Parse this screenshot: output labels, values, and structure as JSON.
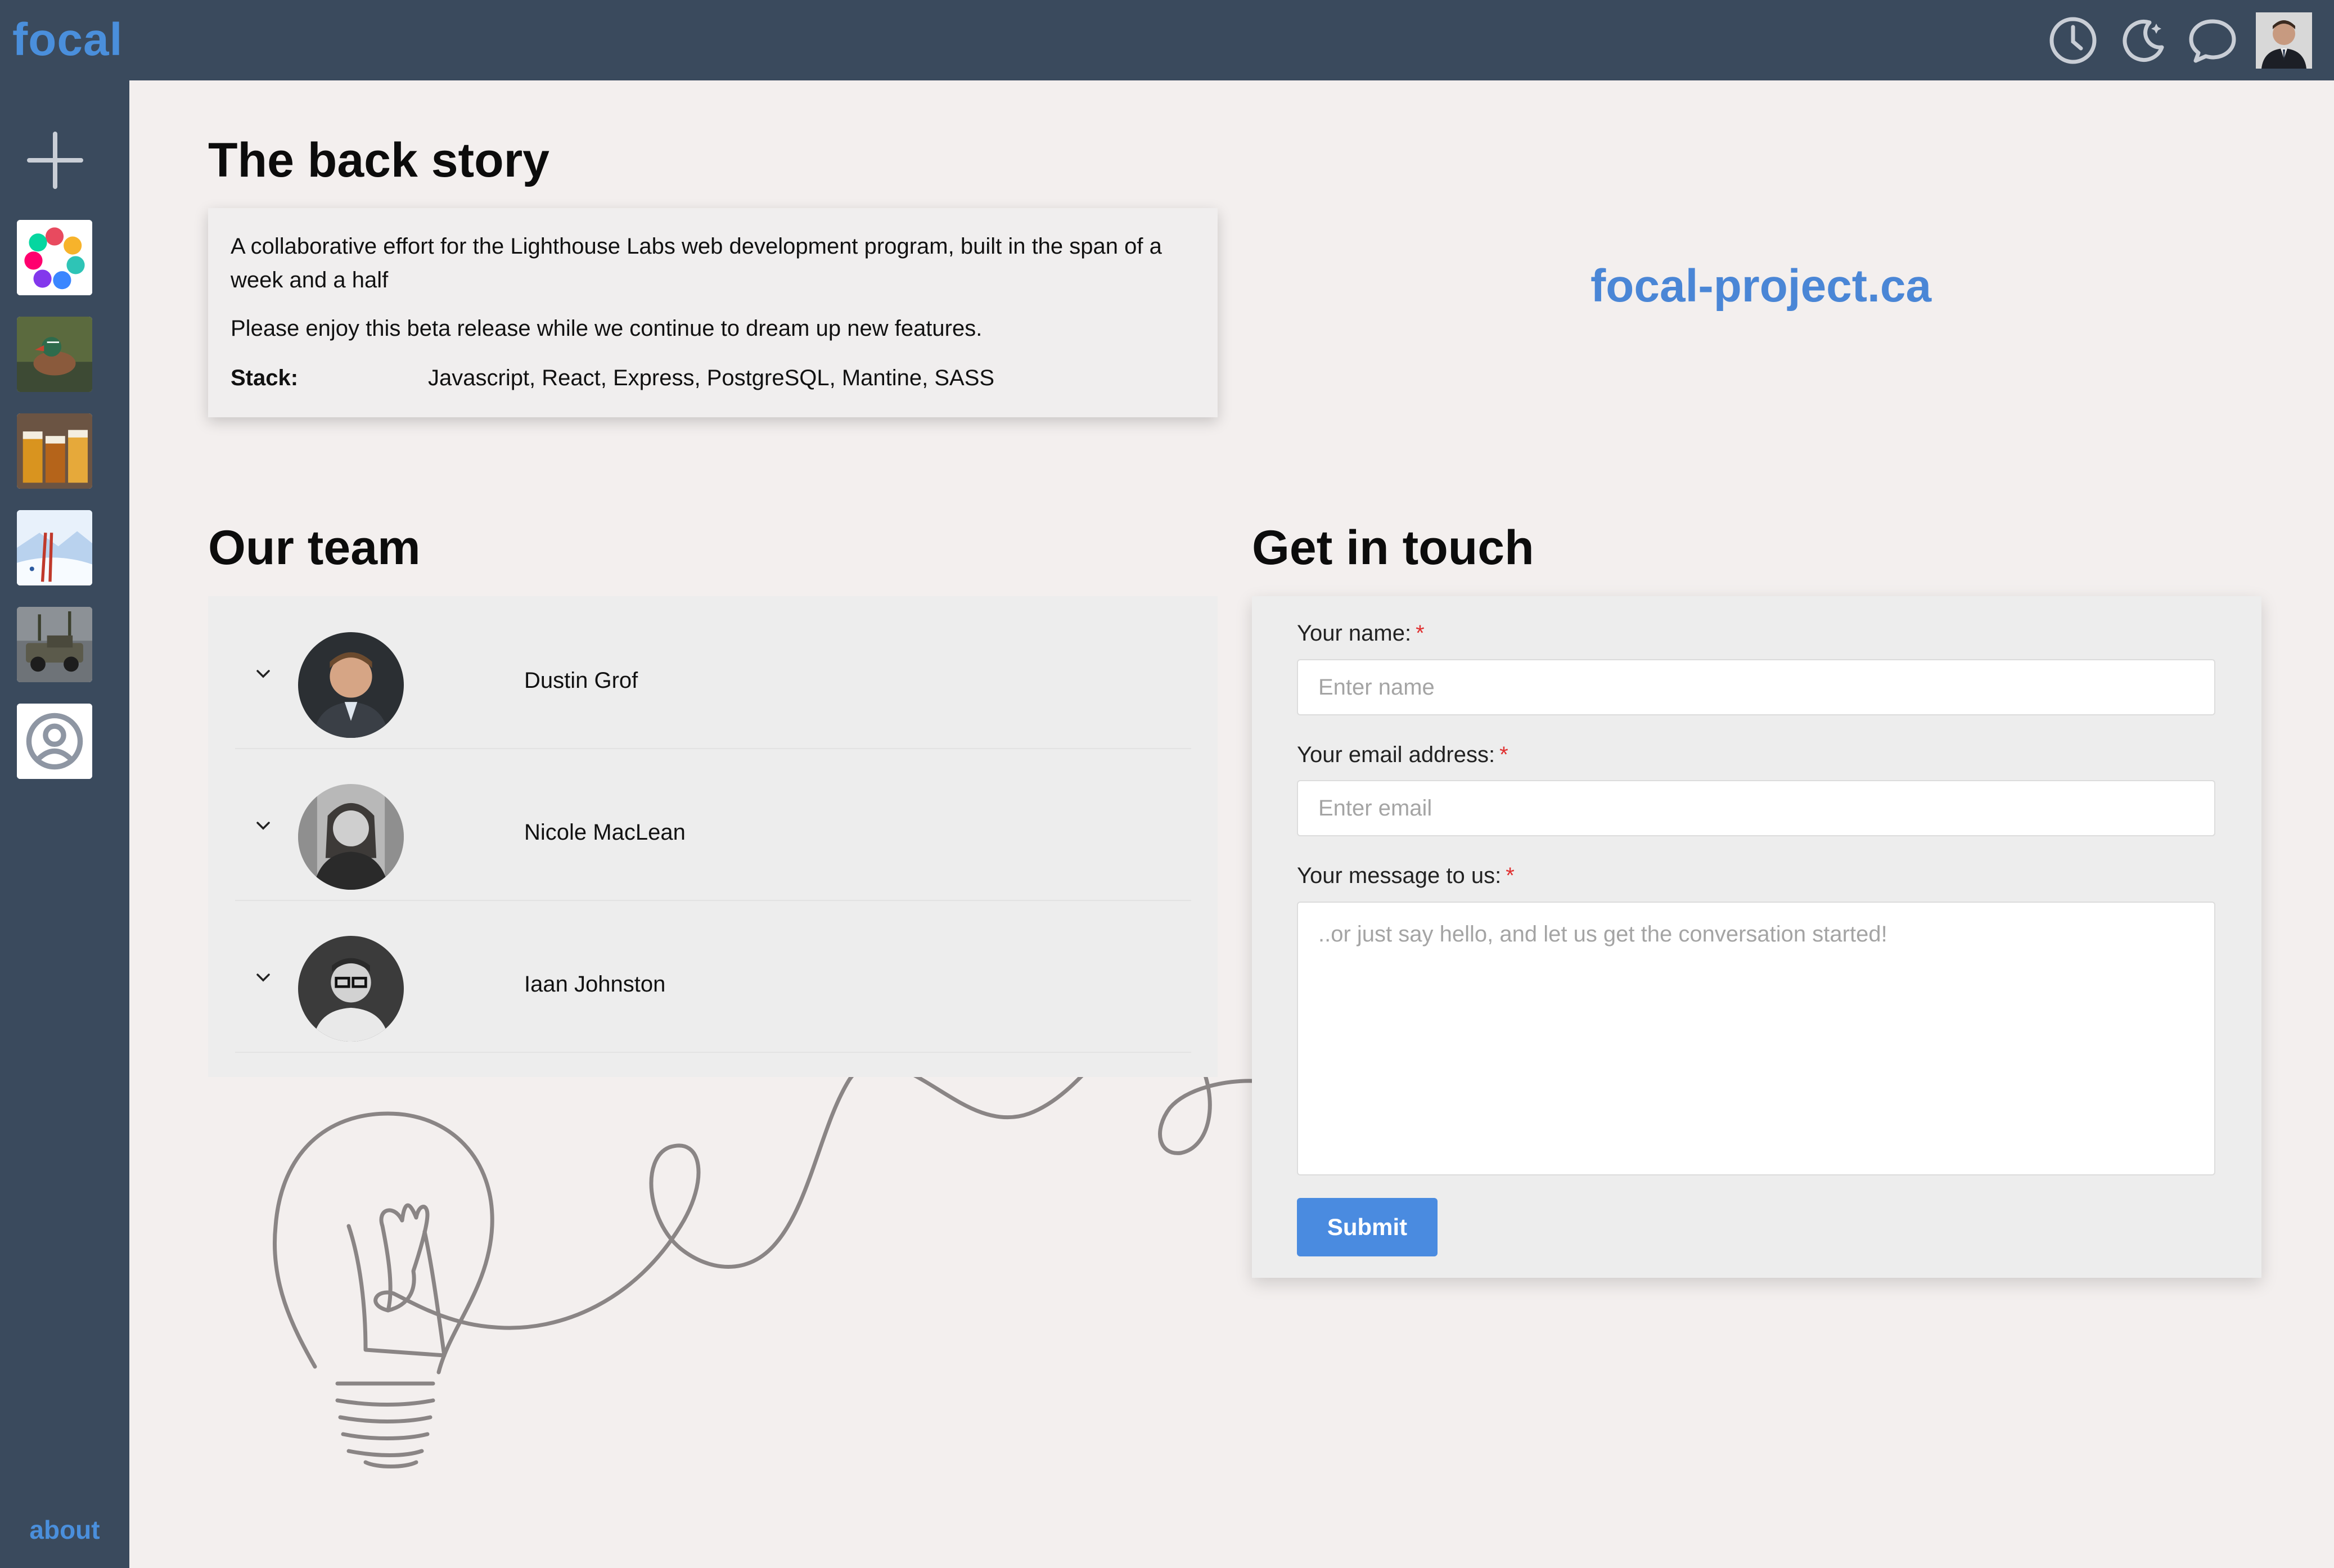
{
  "app": {
    "logo": "focal"
  },
  "topbar": {
    "icons": [
      "clock-icon",
      "dark-mode-moon-icon",
      "chat-bubble-icon",
      "user-avatar"
    ]
  },
  "sidebar": {
    "add_icon": "plus-icon",
    "items": [
      {
        "name": "sidebar-item-logo-board",
        "icon": "colorful-logo"
      },
      {
        "name": "sidebar-item-duck-board",
        "icon": "duck-photo"
      },
      {
        "name": "sidebar-item-beer-board",
        "icon": "beer-photo"
      },
      {
        "name": "sidebar-item-ski-board",
        "icon": "ski-illustration"
      },
      {
        "name": "sidebar-item-truck-board",
        "icon": "truck-photo"
      },
      {
        "name": "sidebar-item-profile",
        "icon": "user-circle-icon"
      }
    ],
    "about_label": "about"
  },
  "backstory": {
    "heading": "The back story",
    "paragraph1": "A collaborative effort for the Lighthouse Labs web development program, built in the span of a week and a half",
    "paragraph2": "Please enjoy this beta release while we continue to dream up new features.",
    "stack_label": "Stack:",
    "stack_value": "Javascript, React, Express, PostgreSQL, Mantine, SASS"
  },
  "site_link": "focal-project.ca",
  "team": {
    "heading": "Our team",
    "members": [
      {
        "name": "Dustin Grof"
      },
      {
        "name": "Nicole MacLean"
      },
      {
        "name": "Iaan Johnston"
      }
    ]
  },
  "contact": {
    "heading": "Get in touch",
    "name_label": "Your name:",
    "name_placeholder": "Enter name",
    "email_label": "Your email address:",
    "email_placeholder": "Enter email",
    "message_label": "Your message to us:",
    "message_placeholder": "..or just say hello, and let us get the conversation started!",
    "required_marker": "*",
    "submit_label": "Submit"
  },
  "colors": {
    "nav_bg": "#3a4a5d",
    "page_bg": "#f3efee",
    "accent": "#4a8fdc",
    "button": "#4a8be0",
    "required": "#e03131"
  }
}
